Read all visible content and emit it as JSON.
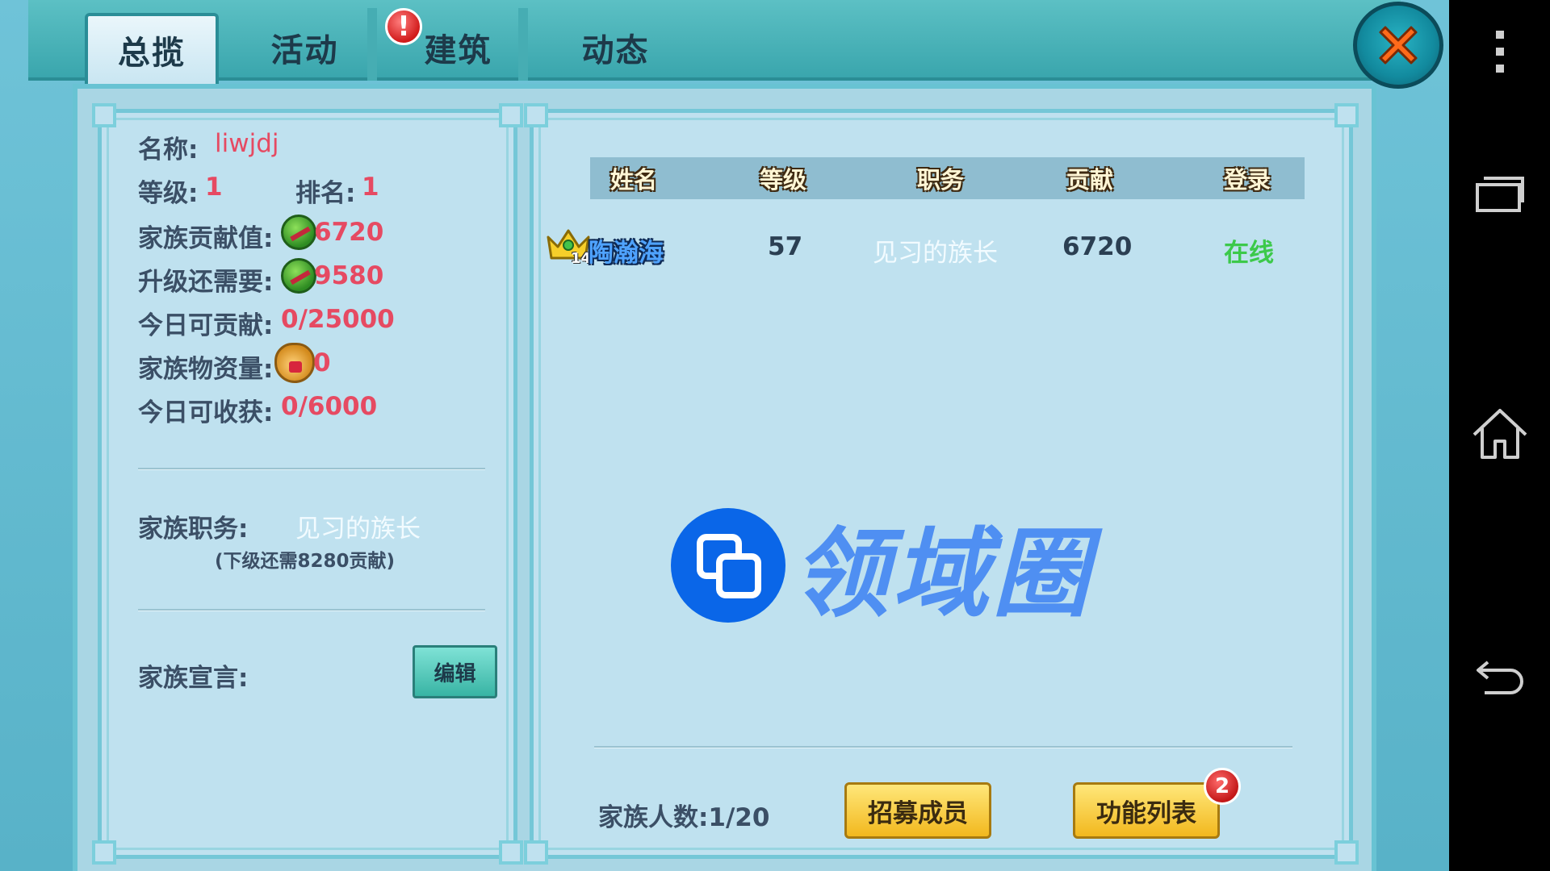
{
  "tabs": [
    {
      "label": "总揽",
      "active": true
    },
    {
      "label": "活动",
      "active": false,
      "badge": "!"
    },
    {
      "label": "建筑",
      "active": false
    },
    {
      "label": "动态",
      "active": false
    }
  ],
  "overview": {
    "name_label": "名称:",
    "name_value": "liwjdj",
    "level_label": "等级:",
    "level_value": "1",
    "rank_label": "排名:",
    "rank_value": "1",
    "contribution_label": "家族贡献值:",
    "contribution_value": "6720",
    "upgrade_label": "升级还需要:",
    "upgrade_value": "9580",
    "today_contrib_label": "今日可贡献:",
    "today_contrib_value": "0/25000",
    "supplies_label": "家族物资量:",
    "supplies_value": "0",
    "today_harvest_label": "今日可收获:",
    "today_harvest_value": "0/6000",
    "position_label": "家族职务:",
    "position_value": "见习的族长",
    "position_next": "(下级还需8280贡献)",
    "declaration_label": "家族宣言:",
    "edit_button": "编辑"
  },
  "members": {
    "headers": [
      "姓名",
      "等级",
      "职务",
      "贡献",
      "登录"
    ],
    "rows": [
      {
        "name": "陶瀚海",
        "crown_level": "14",
        "level": "57",
        "role": "见习的族长",
        "contribution": "6720",
        "status": "在线"
      }
    ],
    "count_label": "家族人数:1/20",
    "recruit_button": "招募成员",
    "function_button": "功能列表",
    "function_badge": "2"
  },
  "watermark": {
    "text": "领域圈"
  },
  "colors": {
    "accent_red": "#e64a62",
    "online_green": "#3cc94a",
    "role_white": "#f2fbff",
    "label_dark": "#3b4f66",
    "frame_teal": "#68c3d3"
  }
}
